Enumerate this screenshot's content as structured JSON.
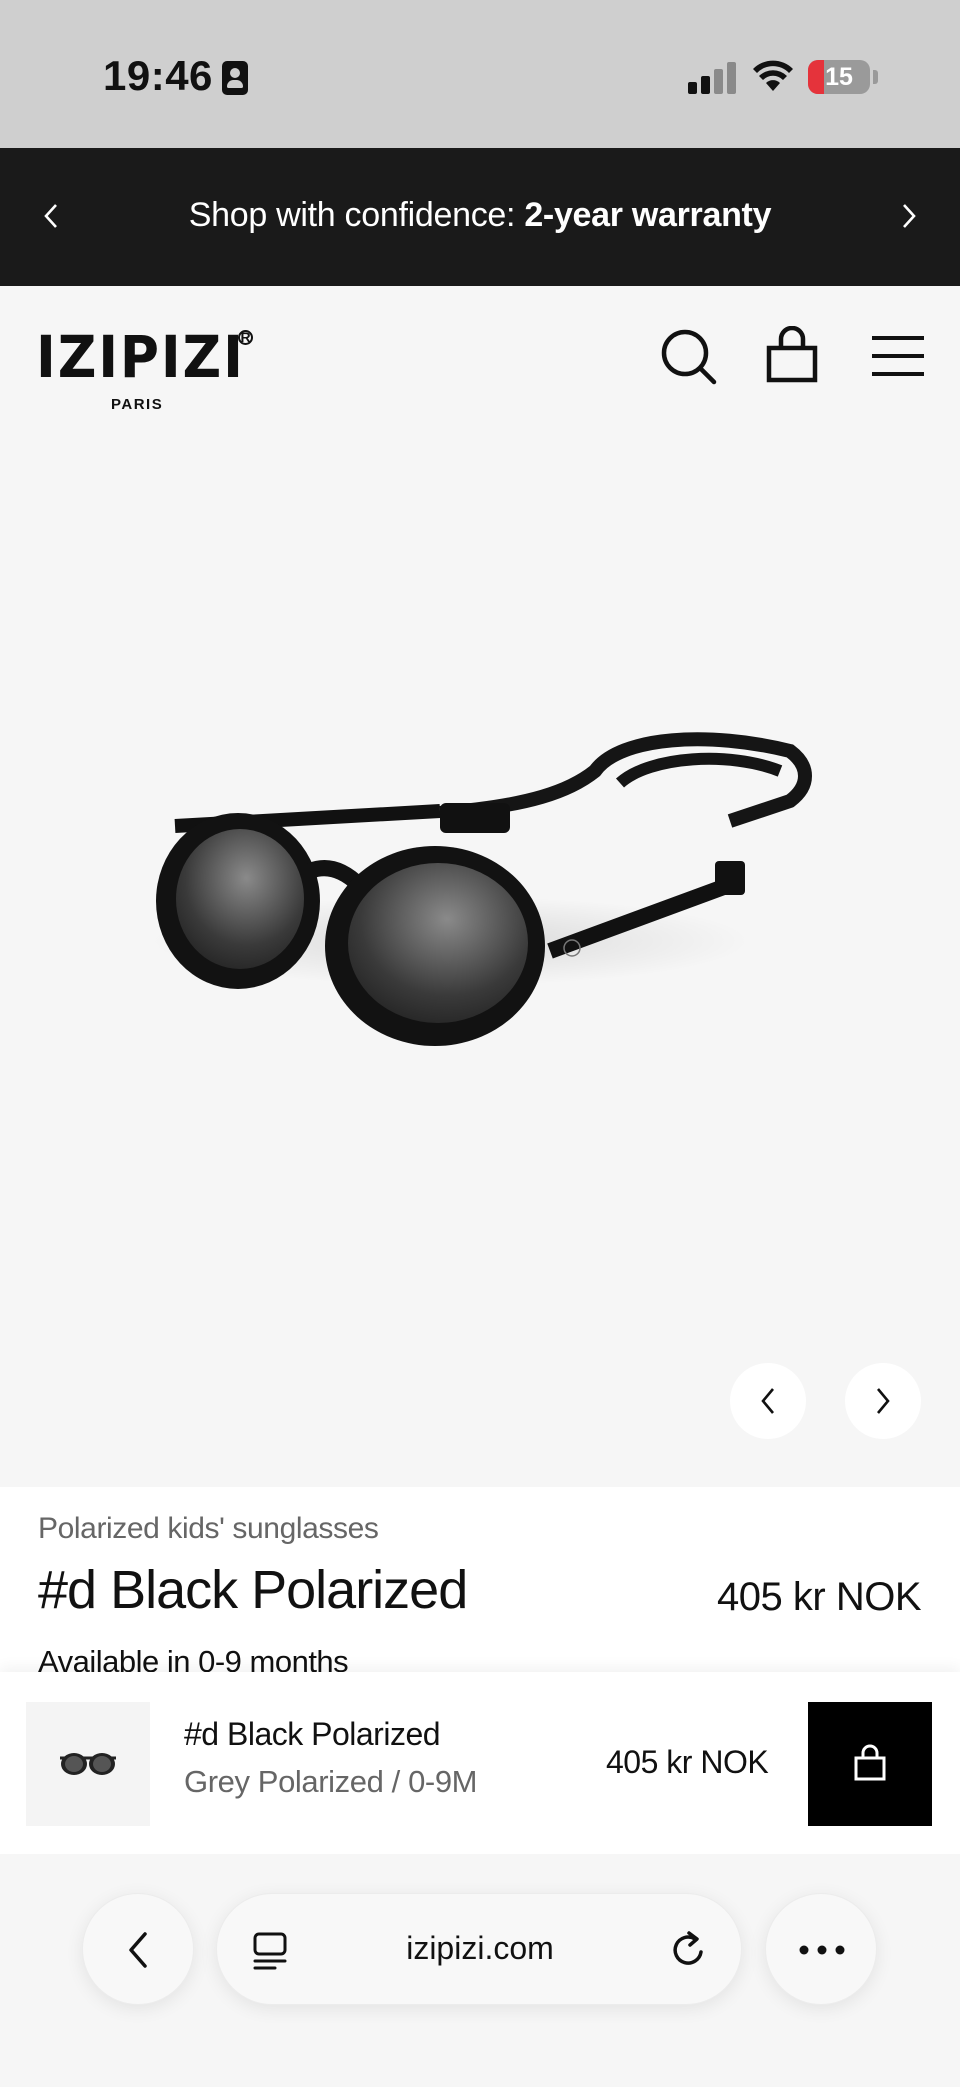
{
  "status_bar": {
    "time": "19:46",
    "battery": "15"
  },
  "promo": {
    "text_regular": "Shop with confidence: ",
    "text_bold": "2-year warranty"
  },
  "brand": {
    "name": "IZIPIZI",
    "city": "PARIS",
    "reg": "R"
  },
  "product": {
    "category": "Polarized kids' sunglasses",
    "name": "#d Black Polarized",
    "price": "405 kr NOK",
    "availability": "Available in 0-9 months"
  },
  "sticky_bar": {
    "name": "#d Black Polarized",
    "variant": "Grey Polarized / 0-9M",
    "price": "405 kr NOK"
  },
  "browser": {
    "url": "izipizi.com"
  },
  "colors": {
    "promo_bg": "#1a1a1a",
    "battery_low": "#e5333b",
    "cart_bg": "#000000"
  }
}
